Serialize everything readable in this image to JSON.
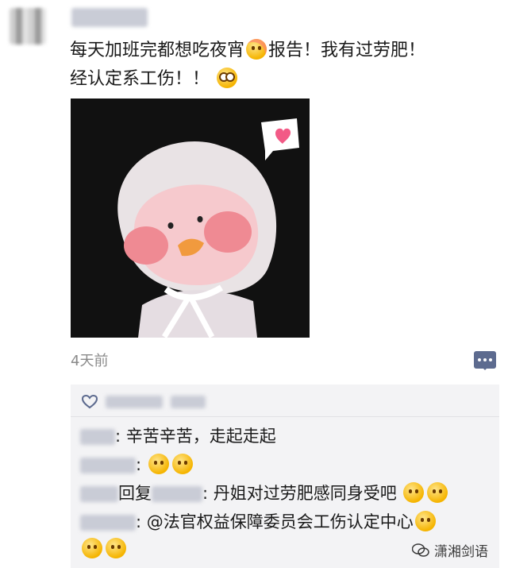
{
  "post": {
    "text_1": "每天加班完都想吃夜宵",
    "text_2": "报告！我有过劳肥！",
    "text_3": "经认定系工伤！！",
    "timestamp": "4天前"
  },
  "comments": [
    {
      "text": ": 辛苦辛苦，走起走起"
    },
    {
      "text": ":"
    },
    {
      "reply_word": "回复",
      "text": ": 丹姐对过劳肥感同身受吧"
    },
    {
      "text": ": @法官权益保障委员会工伤认定中心"
    }
  ],
  "watermark": "潇湘剑语",
  "colors": {
    "accent": "#5d6b8f",
    "panel": "#f3f3f5",
    "emoji": "#f5b400"
  },
  "icons": [
    "heart-outline-icon",
    "comment-icon",
    "emoji-laugh-cry-icon",
    "emoji-grin-icon",
    "wechat-logo-icon"
  ]
}
